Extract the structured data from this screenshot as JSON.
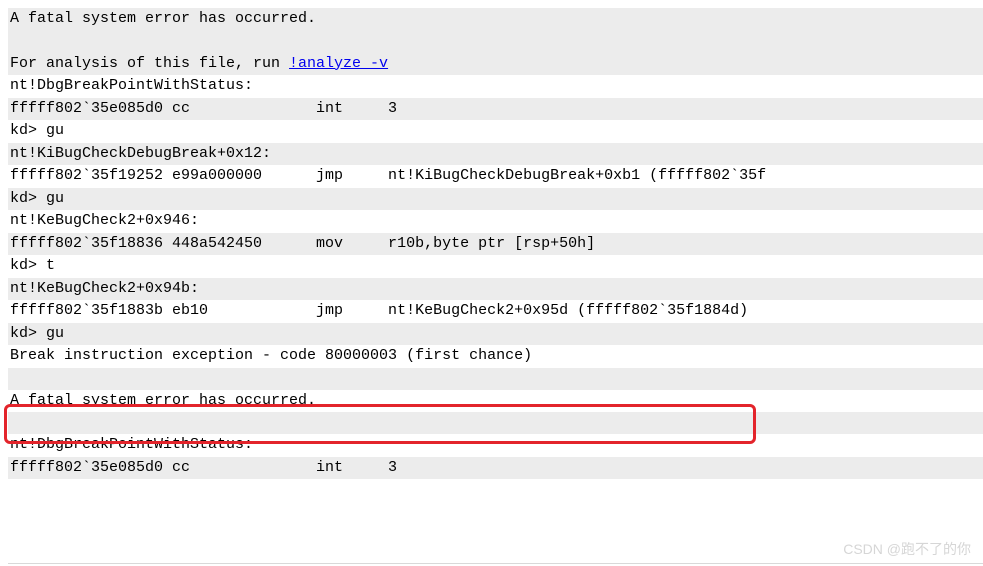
{
  "lines": {
    "l01": "A fatal system error has occurred.",
    "l02": "",
    "l03_pre": "For analysis of this file, run ",
    "l03_link": "!analyze -v",
    "l04": "nt!DbgBreakPointWithStatus:",
    "l05": "fffff802`35e085d0 cc              int     3",
    "l06": "kd> gu",
    "l07": "nt!KiBugCheckDebugBreak+0x12:",
    "l08": "fffff802`35f19252 e99a000000      jmp     nt!KiBugCheckDebugBreak+0xb1 (fffff802`35f",
    "l09": "kd> gu",
    "l10": "nt!KeBugCheck2+0x946:",
    "l11": "fffff802`35f18836 448a542450      mov     r10b,byte ptr [rsp+50h]",
    "l12": "kd> t",
    "l13": "nt!KeBugCheck2+0x94b:",
    "l14": "fffff802`35f1883b eb10            jmp     nt!KeBugCheck2+0x95d (fffff802`35f1884d)",
    "l15": "kd> gu",
    "l16": "Break instruction exception - code 80000003 (first chance)",
    "l17": "",
    "l18": "A fatal system error has occurred.",
    "l19": "",
    "l20": "nt!DbgBreakPointWithStatus:",
    "l21": "fffff802`35e085d0 cc              int     3"
  },
  "watermark": "CSDN @跑不了的你"
}
